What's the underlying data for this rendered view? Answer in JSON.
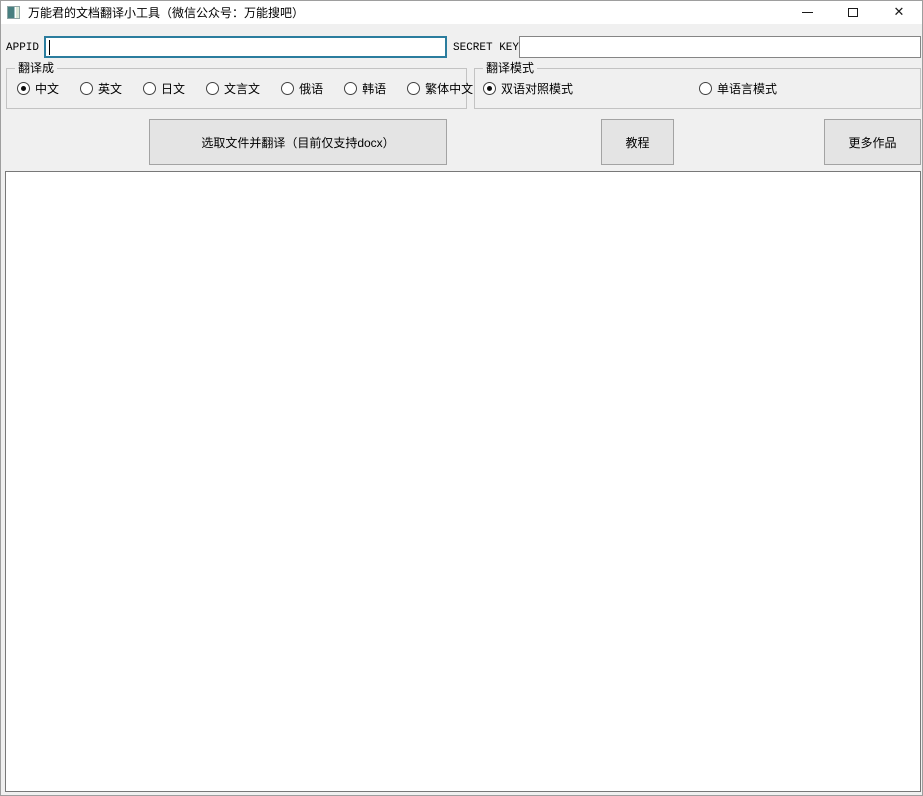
{
  "window": {
    "title": "万能君的文档翻译小工具（微信公众号：万能搜吧）",
    "icons": {
      "app_icon": "app-icon",
      "minimize": "minimize-icon",
      "maximize": "maximize-icon",
      "close": "close-icon"
    },
    "close_glyph": "✕"
  },
  "credentials": {
    "appid": {
      "label": "APPID",
      "value": "",
      "placeholder": ""
    },
    "secret_key": {
      "label": "SECRET KEY",
      "value": "",
      "placeholder": ""
    }
  },
  "translate_to": {
    "legend": "翻译成",
    "options": [
      {
        "label": "中文",
        "selected": true
      },
      {
        "label": "英文",
        "selected": false
      },
      {
        "label": "日文",
        "selected": false
      },
      {
        "label": "文言文",
        "selected": false
      },
      {
        "label": "俄语",
        "selected": false
      },
      {
        "label": "韩语",
        "selected": false
      },
      {
        "label": "繁体中文",
        "selected": false
      }
    ]
  },
  "translate_mode": {
    "legend": "翻译模式",
    "options": [
      {
        "label": "双语对照模式",
        "selected": true
      },
      {
        "label": "单语言模式",
        "selected": false
      }
    ]
  },
  "actions": {
    "select_file": "选取文件并翻译（目前仅支持docx）",
    "tutorial": "教程",
    "more_works": "更多作品"
  },
  "output": {
    "value": ""
  },
  "colors": {
    "titlebar_bg": "#ffffff",
    "content_bg": "#f0f0f0",
    "focus_border": "#2b7d9e",
    "input_border": "#858585",
    "button_bg": "#e4e4e4",
    "button_border": "#a3a3a3",
    "groupbox_border": "#c3c3c3",
    "textarea_border": "#787878"
  }
}
